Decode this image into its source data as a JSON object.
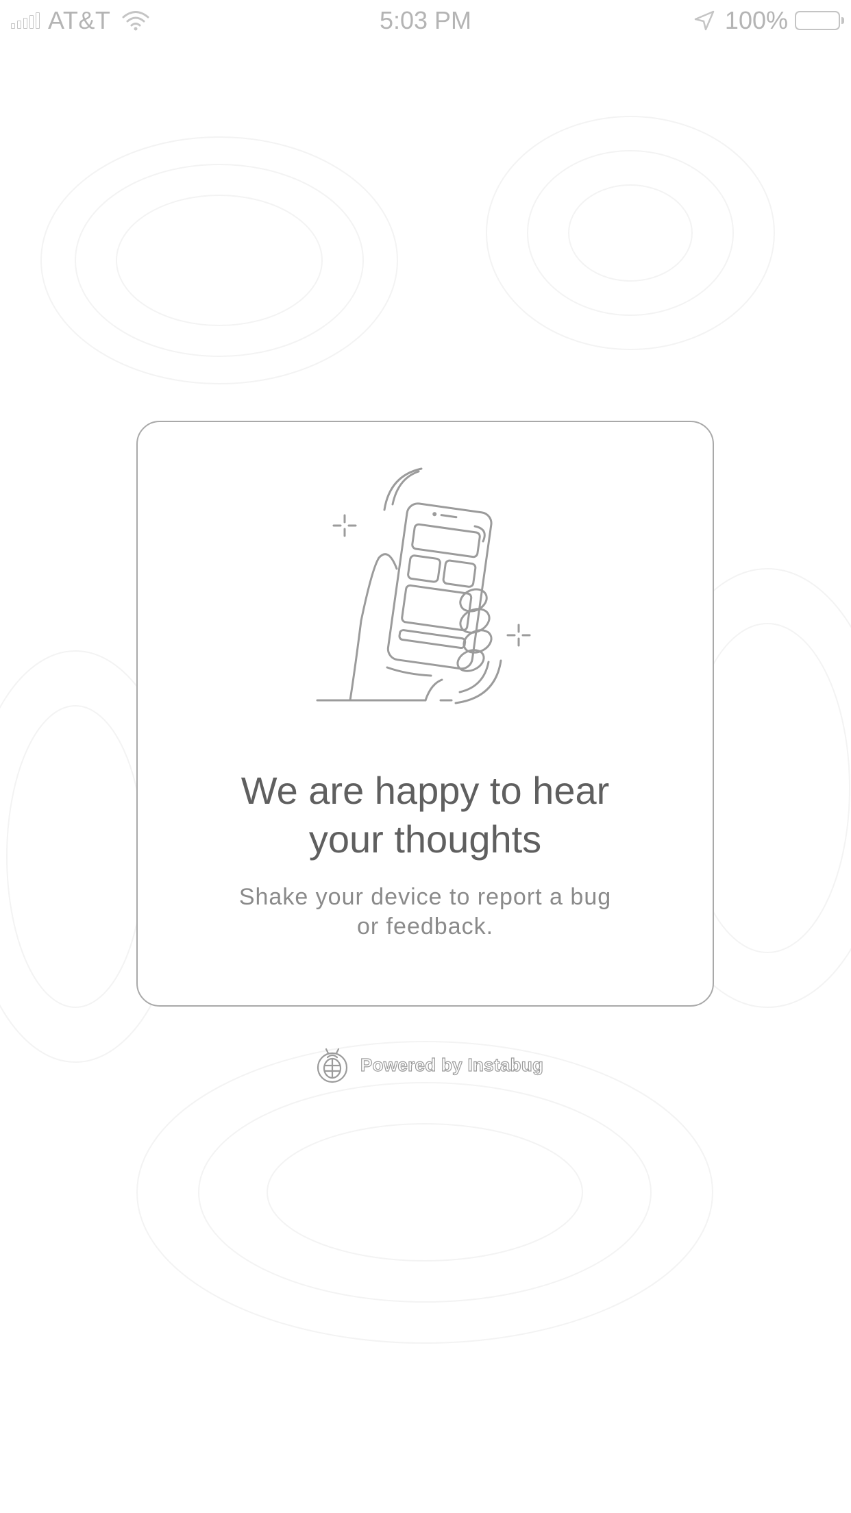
{
  "status_bar": {
    "carrier": "AT&T",
    "time": "5:03 PM",
    "battery_percent": "100%",
    "signal_icon": "signal-bars-icon",
    "wifi_icon": "wifi-icon",
    "location_icon": "location-arrow-icon",
    "battery_icon": "battery-icon"
  },
  "prompt_card": {
    "illustration": "hand-shaking-phone-illustration",
    "title_line1": "We are happy to hear",
    "title_line2": "your thoughts",
    "subtitle_line1": "Shake your device to report a bug",
    "subtitle_line2": "or feedback."
  },
  "footer": {
    "powered_by": "Powered by Instabug",
    "logo_icon": "instabug-logo-icon"
  },
  "colors": {
    "background": "#ffffff",
    "card_border": "#a9a9a9",
    "title_text": "#5f5f5f",
    "subtitle_text": "#8a8a8a",
    "status_text": "#b4b4b4"
  }
}
